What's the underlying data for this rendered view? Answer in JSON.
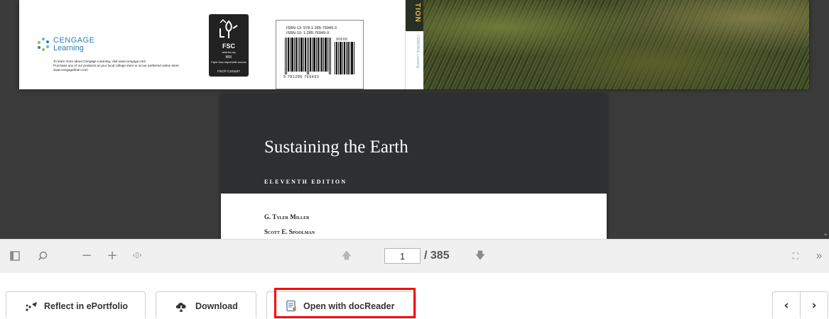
{
  "document": {
    "back_cover": {
      "publisher_name": "CENGAGE",
      "publisher_sub": "Learning",
      "publisher_info_1": "To learn more about Cengage Learning, visit www.cengage.com",
      "publisher_info_2": "Purchase any of our products at your local college store or at our preferred online store www.cengagebrain.com",
      "fsc_label": "FSC",
      "fsc_web": "www.fsc.org",
      "fsc_mix": "MIX",
      "fsc_text": "Paper from responsible sources",
      "fsc_code": "FSC® C101537",
      "isbn_13": "ISBN-13: 978-1-285-76949-3",
      "isbn_10": "ISBN-10: 1-285-76949-X",
      "barcode_digits": "9 781285 769493",
      "barcode_addon": "90000",
      "spine_word": "TION",
      "spine_logo": "CENGAGE Learning"
    },
    "title_page": {
      "title": "Sustaining the Earth",
      "edition": "ELEVENTH EDITION",
      "author_1": "G. Tyler Miller",
      "author_2": "Scott E. Spoolman"
    }
  },
  "toolbar": {
    "icons": [
      "sidebar-toggle-icon",
      "search-icon",
      "minus-icon",
      "plus-icon",
      "fit-width-icon",
      "arrow-up-icon",
      "arrow-down-icon",
      "fullscreen-icon",
      "double-chevron-right-icon"
    ],
    "current_page": "1",
    "page_total": "/ 385",
    "zoom_out": "−",
    "zoom_in": "+",
    "fit": "‹▯›",
    "prev": "🡅",
    "next": "🡇",
    "fullscreen": "⛶",
    "more": "»"
  },
  "actions": {
    "reflect_label": "Reflect in ePortfolio",
    "download_label": "Download",
    "docreader_label": "Open with docReader",
    "nav_prev": "‹",
    "nav_next": "›",
    "highlight_color": "#ff0000"
  }
}
